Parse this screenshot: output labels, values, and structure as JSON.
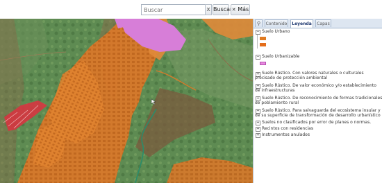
{
  "toolbar": {
    "search_placeholder": "Buscar",
    "clear_label": "x",
    "search_button": "Buscar",
    "more_button": "Más",
    "more_icon": "cross-icon"
  },
  "tabs": [
    {
      "label": "",
      "icon": "search-icon"
    },
    {
      "label": "Contenido"
    },
    {
      "label": "Leyenda",
      "active": true
    },
    {
      "label": "Capas"
    }
  ],
  "legend": {
    "items": [
      {
        "label": "Suelo Urbano"
      },
      {
        "label": "Suelo Urbanizable"
      },
      {
        "label": "Suelo Rústico. Con valores naturales o culturales precisado de protección ambiental"
      },
      {
        "label": "Suelo Rústico. De valor económico y/o establecimiento de infraestructuras"
      },
      {
        "label": "Suelo Rústico. De reconocimiento de formas tradicionales de poblamiento rural"
      },
      {
        "label": "Suelo Rústico. Para salvaguarda del ecosistema insular y de su superficie de transformación de desarrollo urbanístico"
      },
      {
        "label": "Suelos no clasificados por error de planes o normas."
      },
      {
        "label": "Recintos con residencias"
      },
      {
        "label": "Instrumentos anulados"
      }
    ],
    "colors": {
      "urbano_1": "#e07b22",
      "urbano_2": "#e46d1a",
      "urbanizable": "#e88adf"
    }
  },
  "map": {
    "colors": {
      "terrain": "#5f8a52",
      "urbano": "#dc7a27",
      "urbanizable": "#d77ed8",
      "rustico": "#8a6b4a",
      "anulado": "#d63540"
    }
  }
}
